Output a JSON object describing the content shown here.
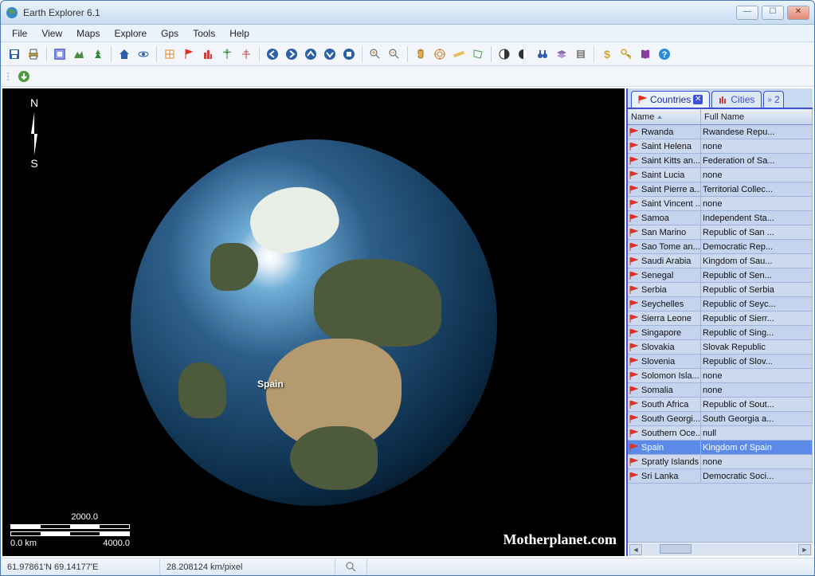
{
  "window": {
    "title": "Earth Explorer 6.1"
  },
  "menu": {
    "file": "File",
    "view": "View",
    "maps": "Maps",
    "explore": "Explore",
    "gps": "Gps",
    "tools": "Tools",
    "help": "Help"
  },
  "map": {
    "label": "Spain",
    "north": "N",
    "south": "S",
    "scale_top": "2000.0",
    "scale_bottom_left": "0.0 km",
    "scale_bottom_right": "4000.0",
    "watermark": "Motherplanet.com"
  },
  "sidepanel": {
    "tabs": {
      "countries": "Countries",
      "cities": "Cities",
      "more": "2"
    },
    "columns": {
      "name": "Name",
      "fullname": "Full Name"
    },
    "rows": [
      {
        "name": "Rwanda",
        "full": "Rwandese Repu..."
      },
      {
        "name": "Saint Helena",
        "full": "none"
      },
      {
        "name": "Saint Kitts an...",
        "full": "Federation of Sa..."
      },
      {
        "name": "Saint Lucia",
        "full": "none"
      },
      {
        "name": "Saint Pierre a...",
        "full": "Territorial Collec..."
      },
      {
        "name": "Saint Vincent ...",
        "full": "none"
      },
      {
        "name": "Samoa",
        "full": "Independent Sta..."
      },
      {
        "name": "San Marino",
        "full": "Republic of San ..."
      },
      {
        "name": "Sao Tome an...",
        "full": "Democratic Rep..."
      },
      {
        "name": "Saudi Arabia",
        "full": "Kingdom of Sau..."
      },
      {
        "name": "Senegal",
        "full": "Republic of Sen..."
      },
      {
        "name": "Serbia",
        "full": "Republic of Serbia"
      },
      {
        "name": "Seychelles",
        "full": "Republic of Seyc..."
      },
      {
        "name": "Sierra Leone",
        "full": "Republic of Sierr..."
      },
      {
        "name": "Singapore",
        "full": "Republic of Sing..."
      },
      {
        "name": "Slovakia",
        "full": "Slovak Republic"
      },
      {
        "name": "Slovenia",
        "full": "Republic of Slov..."
      },
      {
        "name": "Solomon Isla...",
        "full": "none"
      },
      {
        "name": "Somalia",
        "full": "none"
      },
      {
        "name": "South Africa",
        "full": "Republic of Sout..."
      },
      {
        "name": "South Georgi...",
        "full": "South Georgia a..."
      },
      {
        "name": "Southern Oce...",
        "full": "null"
      },
      {
        "name": "Spain",
        "full": "Kingdom of Spain",
        "selected": true
      },
      {
        "name": "Spratly Islands",
        "full": "none"
      },
      {
        "name": "Sri Lanka",
        "full": "Democratic Soci..."
      }
    ]
  },
  "status": {
    "coords": "61.97861'N  69.14177'E",
    "resolution": "28.208124 km/pixel"
  }
}
